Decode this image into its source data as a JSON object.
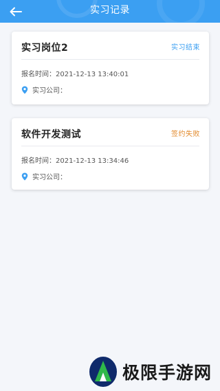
{
  "header": {
    "title": "实习记录",
    "back_icon": "arrow-left-icon",
    "color": "#3b9ff2"
  },
  "records": [
    {
      "title": "实习岗位2",
      "status": "实习结束",
      "status_color": "#3b9ff2",
      "time_label": "报名时间：",
      "time_value": "2021-12-13 13:40:01",
      "company_label": "实习公司："
    },
    {
      "title": "软件开发测试",
      "status": "签约失败",
      "status_color": "#e2892b",
      "time_label": "报名时间：",
      "time_value": "2021-12-13 13:34:46",
      "company_label": "实习公司："
    }
  ],
  "watermark": {
    "text": "极限手游网",
    "icon": "extreme-logo-icon"
  }
}
